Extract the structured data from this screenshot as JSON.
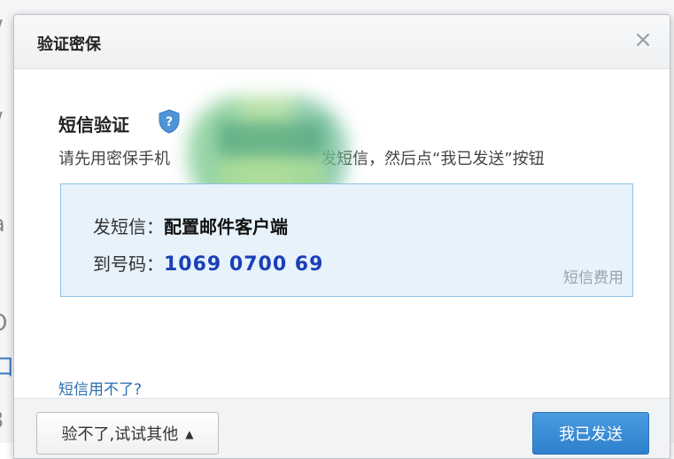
{
  "dialog": {
    "title": "验证密保",
    "close_glyph": "×"
  },
  "sms": {
    "section_title": "短信验证",
    "instruction_prefix": "请先用密保手机",
    "instruction_suffix": "发短信，然后点“我已发送”按钮",
    "send_label": "发短信：",
    "send_content": "配置邮件客户端",
    "to_label": "到号码：",
    "to_number": "1069 0700 69",
    "fee_link": "短信费用"
  },
  "help_link": "短信用不了?",
  "footer": {
    "alt_button": "验不了,试试其他",
    "alt_button_arrow": "▲",
    "sent_button": "我已发送"
  },
  "colors": {
    "accent": "#2f80cc",
    "number": "#1a3fb8",
    "link": "#2b6cb0",
    "box_bg": "#e7f2fb",
    "box_border": "#8cc3e6"
  },
  "icons": {
    "close": "close-icon",
    "shield": "shield-question-icon",
    "arrow": "triangle-up-icon"
  }
}
